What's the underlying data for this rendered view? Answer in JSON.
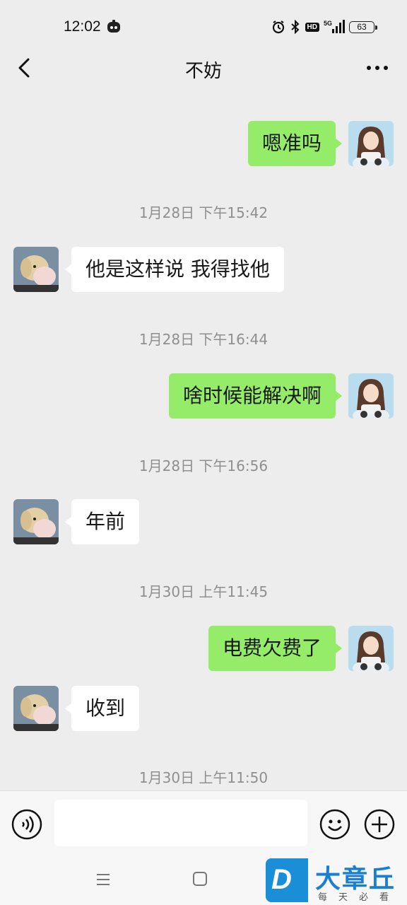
{
  "status_bar": {
    "time": "12:02",
    "network": "5G",
    "hd_label": "HD",
    "battery": "63"
  },
  "header": {
    "title": "不妨",
    "back_icon": "chevron-left-icon",
    "more_icon": "more-dots-icon"
  },
  "messages": [
    {
      "type": "sent",
      "text": "嗯准吗"
    },
    {
      "type": "time",
      "text": "1月28日 下午15:42"
    },
    {
      "type": "received",
      "text": "他是这样说  我得找他"
    },
    {
      "type": "time",
      "text": "1月28日 下午16:44"
    },
    {
      "type": "sent",
      "text": "啥时候能解决啊"
    },
    {
      "type": "time",
      "text": "1月28日 下午16:56"
    },
    {
      "type": "received",
      "text": "年前"
    },
    {
      "type": "time",
      "text": "1月30日 上午11:45"
    },
    {
      "type": "sent",
      "text": "电费欠费了"
    },
    {
      "type": "received",
      "text": "收到"
    },
    {
      "type": "time",
      "text": "1月30日 上午11:50"
    }
  ],
  "input_bar": {
    "value": "",
    "voice_icon": "voice-icon",
    "emoji_icon": "emoji-icon",
    "plus_icon": "plus-icon"
  },
  "watermark": {
    "logo_letter": "D",
    "title": "大章丘",
    "subtitle": "每天必看"
  },
  "colors": {
    "sent_bubble": "#95ec69",
    "received_bubble": "#ffffff",
    "background": "#ededed"
  }
}
